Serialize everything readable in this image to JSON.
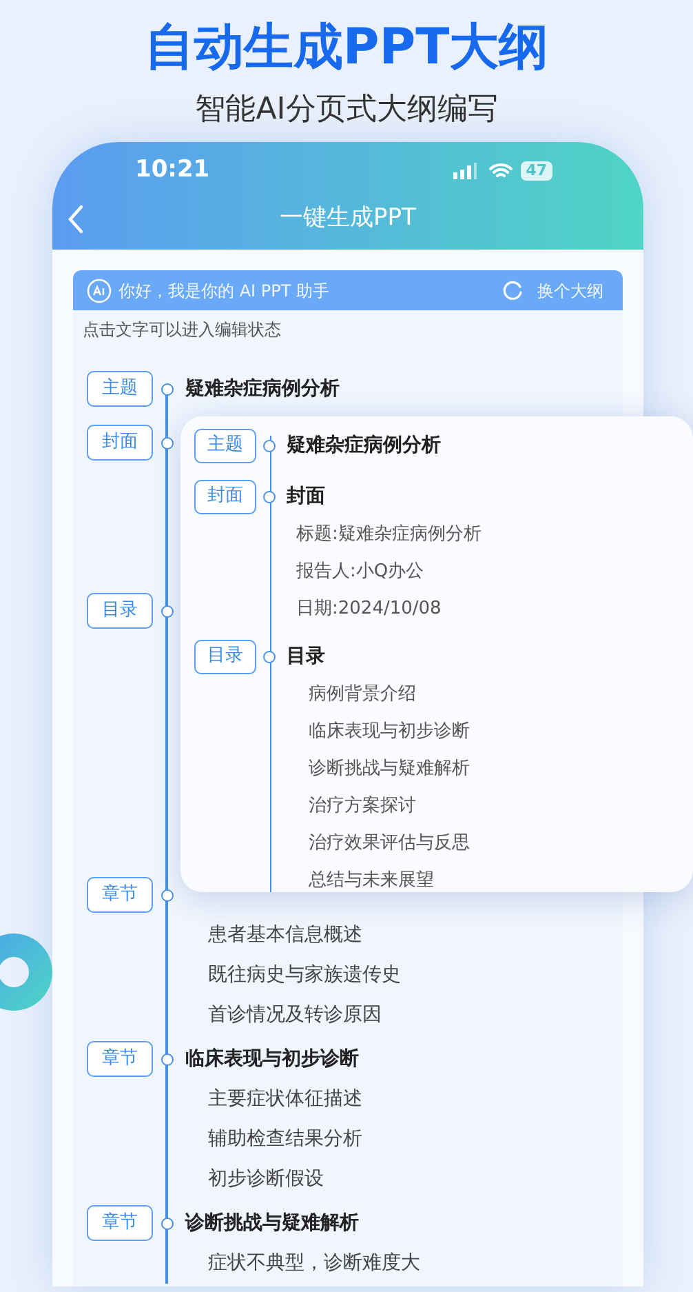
{
  "headline": "自动生成PPT大纲",
  "subheadline": "智能AI分页式大纲编写",
  "status_bar": {
    "time": "10:21",
    "battery": "47"
  },
  "nav": {
    "title": "一键生成PPT"
  },
  "assistant_bar": {
    "greeting": "你好，我是你的 AI PPT 助手",
    "action": "换个大纲"
  },
  "hint": "点击文字可以进入编辑状态",
  "outline": [
    {
      "tag": "主题",
      "title": "疑难杂症病例分析"
    },
    {
      "tag": "封面"
    },
    {
      "tag": "目录"
    },
    {
      "tag": "章节",
      "children": [
        "患者基本信息概述",
        "既往病史与家族遗传史",
        "首诊情况及转诊原因"
      ]
    },
    {
      "tag": "章节",
      "title": "临床表现与初步诊断",
      "children": [
        "主要症状体征描述",
        "辅助检查结果分析",
        "初步诊断假设"
      ]
    },
    {
      "tag": "章节",
      "title": "诊断挑战与疑难解析",
      "children": [
        "症状不典型，诊断难度大"
      ]
    }
  ],
  "popup": [
    {
      "tag": "主题",
      "title": "疑难杂症病例分析",
      "kind": "plain"
    },
    {
      "tag": "封面",
      "title": "封面",
      "kind": "details",
      "children": [
        "标题:疑难杂症病例分析",
        "报告人:小Q办公",
        "日期:2024/10/08"
      ]
    },
    {
      "tag": "目录",
      "title": "目录",
      "kind": "toc",
      "children": [
        "病例背景介绍",
        "临床表现与初步诊断",
        "诊断挑战与疑难解析",
        "治疗方案探讨",
        "治疗效果评估与反思",
        "总结与未来展望"
      ]
    }
  ]
}
